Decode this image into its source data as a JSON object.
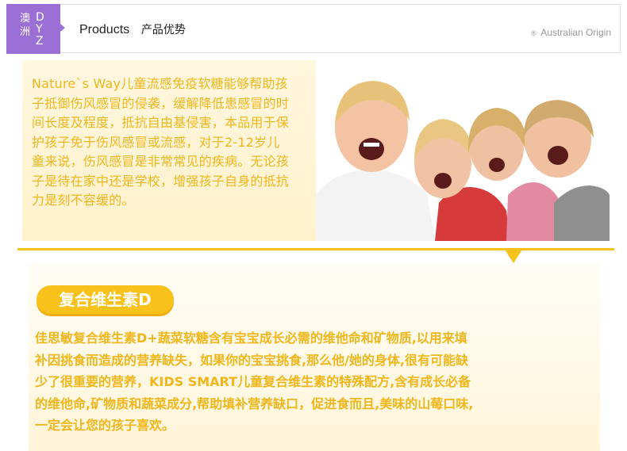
{
  "header": {
    "brand_cn_1": "澳",
    "brand_cn_2": "洲",
    "brand_letter_1": "D",
    "brand_letter_2": "Y",
    "brand_letter_3": "Z",
    "title_en": "Products",
    "title_zh": "产品优势",
    "origin_mark": "®",
    "origin_text": "Australian Origin"
  },
  "intro": {
    "lines": [
      "Nature`s Way儿童流感免疫软糖能够帮助孩",
      "子抵御伤风感冒的侵袭，缓解降低患感冒的时",
      "间长度及程度，抵抗自由基侵害，本品用于保",
      "护孩子免于伤风感冒或流感，对于2-12岁儿",
      "童来说，伤风感冒是非常常见的疾病。无论孩",
      "子是待在家中还是学校，增强孩子自身的抵抗",
      "力是刻不容缓的。"
    ]
  },
  "section": {
    "heading": "复合维生素D",
    "lines": [
      "佳思敏复合维生素D+蔬菜软糖含有宝宝成长必需的维他命和矿物质,以用来填",
      "补因挑食而造成的营养缺失，如果你的宝宝挑食,那么他/她的身体,很有可能缺",
      "少了很重要的营养，KIDS SMART儿童复合维生素的特殊配方,含有成长必备",
      "的维他命,矿物质和蔬菜成分,帮助填补营养缺口，促进食而且,美味的山莓口味,",
      "一定会让您的孩子喜欢。"
    ]
  },
  "colors": {
    "brand_purple": "#9a6fd6",
    "accent_yellow": "#f9c21b",
    "text_yellow": "#f0b61b"
  }
}
